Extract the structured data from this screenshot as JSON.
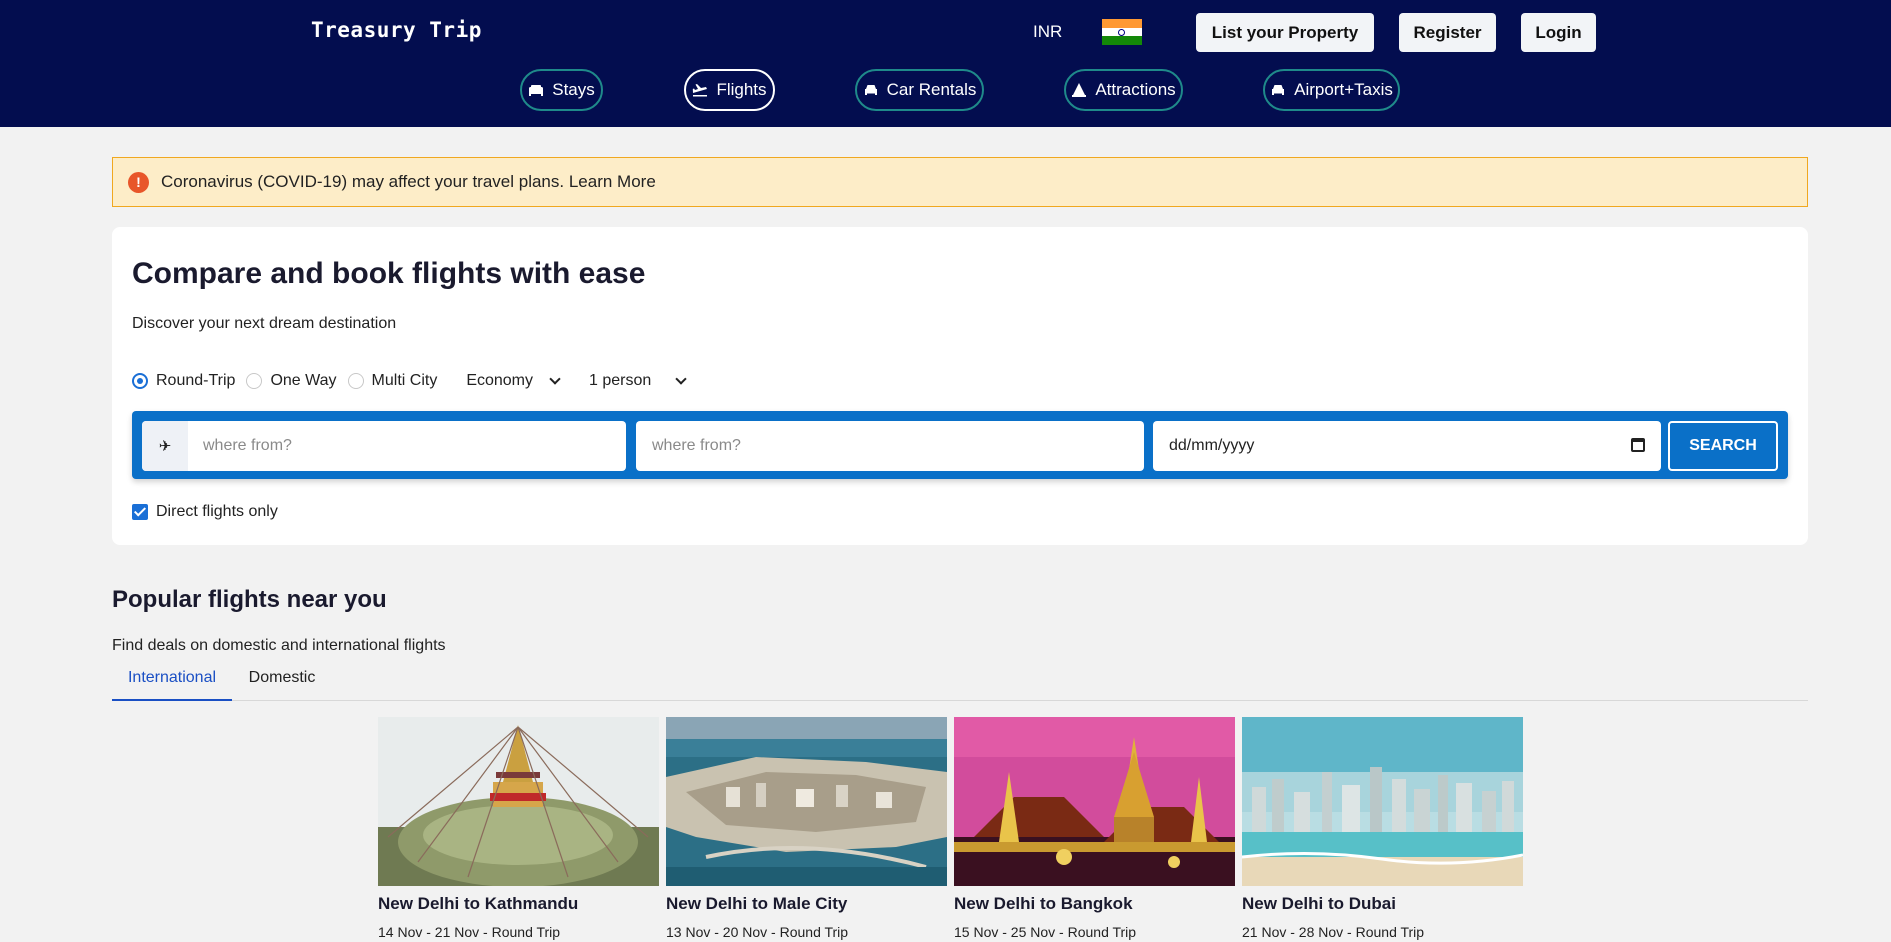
{
  "header": {
    "brand": "Treasury Trip",
    "currency": "INR",
    "flag_icon": "india-flag-icon",
    "buttons": {
      "list_property": "List your Property",
      "register": "Register",
      "login": "Login"
    },
    "nav": [
      {
        "label": "Stays",
        "icon": "bed-icon"
      },
      {
        "label": "Flights",
        "icon": "plane-icon",
        "active": true
      },
      {
        "label": "Car Rentals",
        "icon": "car-icon"
      },
      {
        "label": "Attractions",
        "icon": "attractions-icon"
      },
      {
        "label": "Airport+Taxis",
        "icon": "taxi-icon"
      }
    ],
    "colors": {
      "background": "#030d4f",
      "pill_border": "#1f8a8a"
    }
  },
  "alert": {
    "icon": "exclamation-icon",
    "text": "Coronavirus (COVID-19) may affect your travel plans. Learn More"
  },
  "search": {
    "title": "Compare and book flights with ease",
    "subtitle": "Discover your next dream destination",
    "trip_types": [
      "Round-Trip",
      "One Way",
      "Multi City"
    ],
    "selected_trip_type": "Round-Trip",
    "cabin_class": "Economy",
    "passengers": "1 person",
    "from_placeholder": "where from?",
    "to_placeholder": "where from?",
    "date_placeholder": "dd/mm/yyyy",
    "search_button": "SEARCH",
    "direct_only_label": "Direct flights only",
    "direct_only_checked": true,
    "colors": {
      "bar": "#0a70c8"
    }
  },
  "popular": {
    "title": "Popular flights near you",
    "subtitle": "Find deals on domestic and international flights",
    "tabs": [
      "International",
      "Domestic"
    ],
    "active_tab": "International",
    "destinations": [
      {
        "title": "New Delhi to Kathmandu",
        "dates": "14 Nov - 21 Nov - Round Trip",
        "image": "stupa-image"
      },
      {
        "title": "New Delhi to Male City",
        "dates": "13 Nov - 20 Nov - Round Trip",
        "image": "island-city-image"
      },
      {
        "title": "New Delhi to Bangkok",
        "dates": "15 Nov - 25 Nov - Round Trip",
        "image": "temple-image"
      },
      {
        "title": "New Delhi to Dubai",
        "dates": "21 Nov - 28 Nov - Round Trip",
        "image": "skyline-image"
      }
    ]
  }
}
